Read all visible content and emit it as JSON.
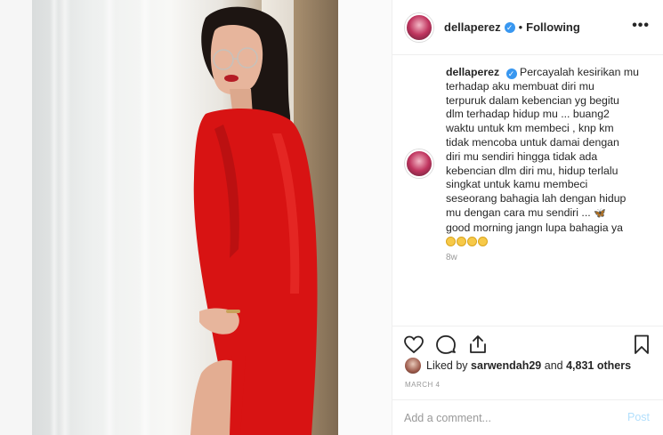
{
  "post": {
    "username": "dellaperez",
    "verified_glyph": "✓",
    "separator": "•",
    "follow_status": "Following",
    "more_glyph": "•••",
    "caption_first": "Percayalah kesirikan mu",
    "caption_rest": "terhadap aku membuat diri mu\nterpuruk dalam kebencian yg begitu\ndlm terhadap hidup mu ... buang2\nwaktu untuk km membeci , knp km\ntidak mencoba untuk damai dengan\ndiri mu sendiri hingga tidak ada\nkebencian dlm diri mu, hidup terlalu\nsingkat untuk kamu membeci\nseseorang bahagia lah dengan hidup\nmu dengan cara mu sendiri ...",
    "caption_last": "good morning jangn lupa bahagia ya",
    "butterfly_glyph": "🦋",
    "emoji_count": 4,
    "time_ago": "8w",
    "likes_prefix": "Liked by ",
    "likes_user": "sarwendah29",
    "likes_mid": " and ",
    "likes_count": "4,831 others",
    "date": "MARCH 4"
  },
  "comment_box": {
    "placeholder": "Add a comment...",
    "post_label": "Post"
  },
  "icons": {
    "like": "heart-icon",
    "comment": "comment-icon",
    "share": "share-icon",
    "save": "bookmark-icon"
  },
  "colors": {
    "verified": "#3897f0",
    "dress": "#d81313",
    "post_button": "#b2dffc"
  }
}
